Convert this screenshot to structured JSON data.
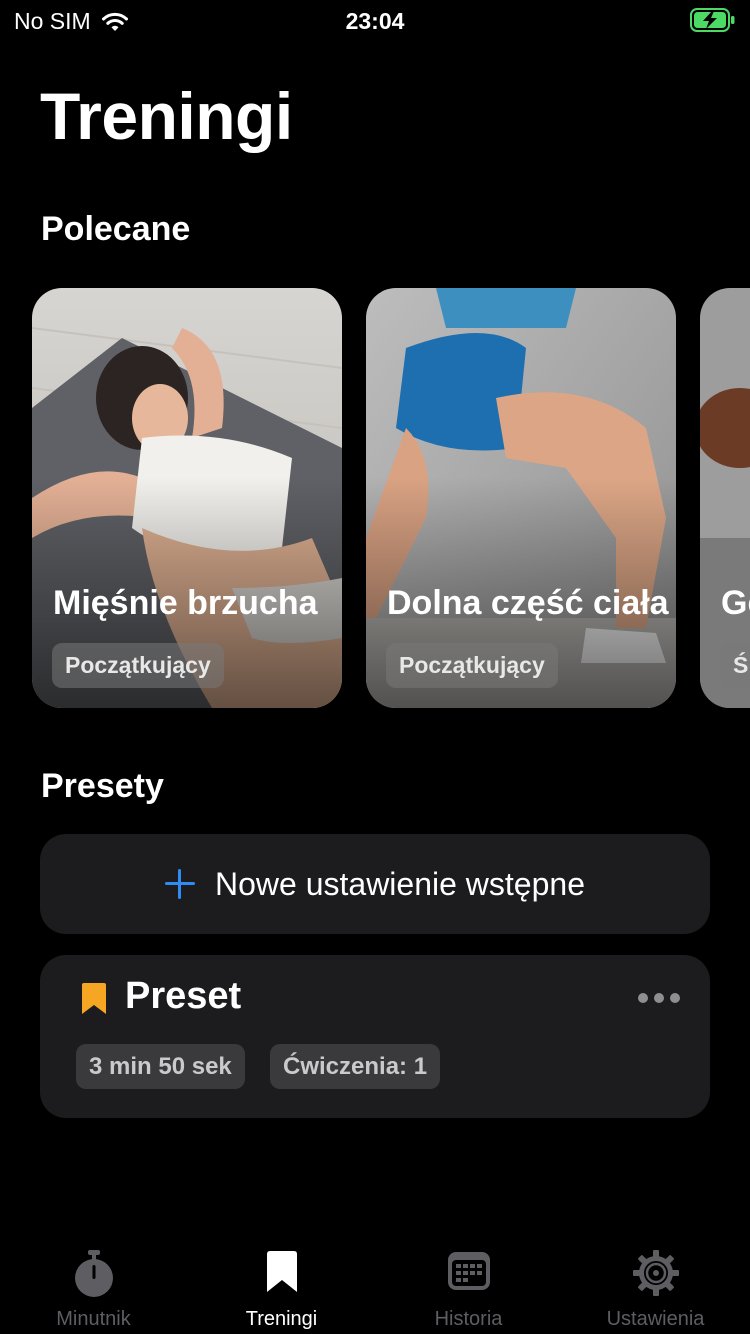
{
  "status": {
    "carrier": "No SIM",
    "time": "23:04"
  },
  "page": {
    "title": "Treningi"
  },
  "recommended": {
    "title": "Polecane",
    "cards": [
      {
        "title": "Mięśnie brzucha",
        "level": "Początkujący"
      },
      {
        "title": "Dolna część ciała",
        "level": "Początkujący"
      },
      {
        "title": "Ge",
        "level": "Ś"
      }
    ]
  },
  "presets": {
    "title": "Presety",
    "new_label": "Nowe ustawienie wstępne",
    "items": [
      {
        "name": "Preset",
        "duration": "3 min 50 sek",
        "exercises": "Ćwiczenia: 1"
      }
    ]
  },
  "tabs": [
    {
      "label": "Minutnik",
      "icon": "stopwatch-icon"
    },
    {
      "label": "Treningi",
      "icon": "bookmark-icon"
    },
    {
      "label": "Historia",
      "icon": "calendar-icon"
    },
    {
      "label": "Ustawienia",
      "icon": "gear-icon"
    }
  ],
  "active_tab": "Treningi",
  "colors": {
    "accent": "#2f8cf5",
    "bookmark": "#f5a623",
    "card_bg": "#1c1c1e"
  }
}
